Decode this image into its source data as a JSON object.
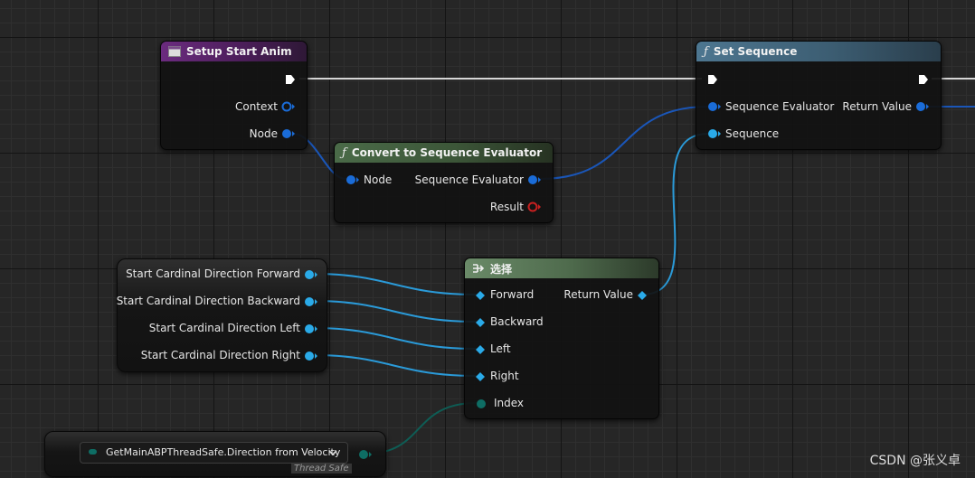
{
  "nodes": {
    "setup_start_anim": {
      "title": "Setup Start Anim",
      "pins": {
        "context": "Context",
        "node": "Node"
      }
    },
    "set_sequence": {
      "title": "Set Sequence",
      "pins": {
        "sequence_evaluator": "Sequence Evaluator",
        "sequence": "Sequence",
        "return_value": "Return Value"
      }
    },
    "convert": {
      "title": "Convert to Sequence Evaluator",
      "pins": {
        "node": "Node",
        "sequence_evaluator": "Sequence Evaluator",
        "result": "Result"
      }
    },
    "select": {
      "title": "选择",
      "pins": {
        "forward": "Forward",
        "backward": "Backward",
        "left": "Left",
        "right": "Right",
        "index": "Index",
        "return_value": "Return Value"
      }
    },
    "variables": {
      "items": [
        "Start Cardinal Direction Forward",
        "Start Cardinal Direction Backward",
        "Start Cardinal Direction Left",
        "Start Cardinal Direction Right"
      ]
    },
    "getter": {
      "value": "GetMainABPThreadSafe.Direction from Velocity",
      "badge": "Thread Safe"
    }
  },
  "watermark": "CSDN @张义卓",
  "icons": {
    "function": "function-icon",
    "event": "anim-event-icon",
    "select": "select-icon",
    "exec": "exec-pin-icon",
    "dropdown": "chevron-down-icon"
  },
  "colors": {
    "wire_object": "#1a56b8",
    "wire_struct": "#2a9ad8",
    "wire_enum": "#0e5d55",
    "wire_exec": "#d6d6d6",
    "header_event": "#6b2b7f",
    "header_function": "#4d7690",
    "header_pure": "#4a6a48"
  }
}
